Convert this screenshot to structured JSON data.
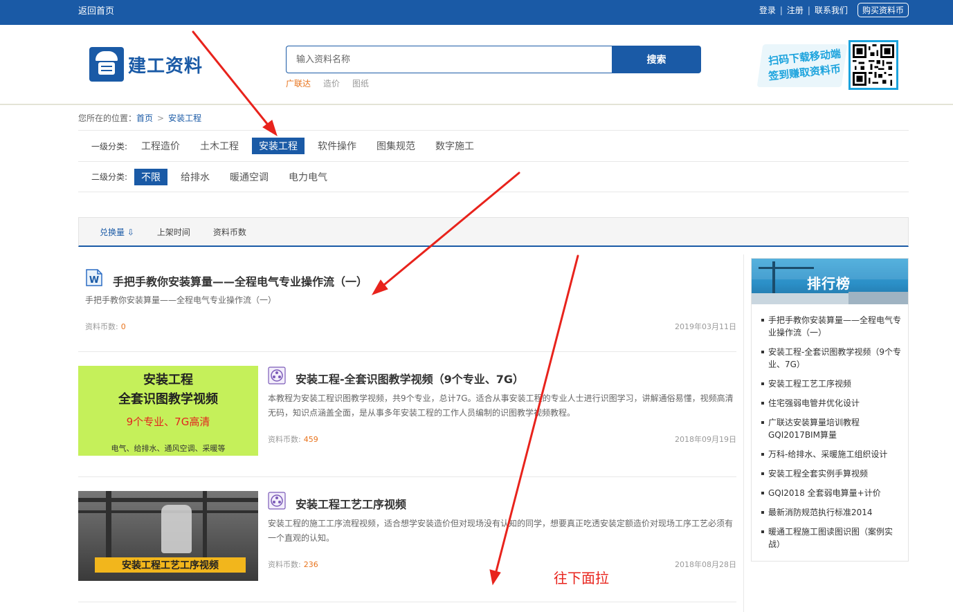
{
  "topbar": {
    "back_label": "返回首页",
    "login": "登录",
    "register": "注册",
    "contact": "联系我们",
    "buy": "购买资料币",
    "separator": "|"
  },
  "header": {
    "logo_text": "建工资料",
    "search_placeholder": "输入资料名称",
    "search_button": "搜索",
    "hot_keywords": [
      "广联达",
      "造价",
      "图纸"
    ],
    "promo_line1": "扫码下载移动端",
    "promo_line2": "签到赚取资料币"
  },
  "breadcrumb": {
    "prefix": "您所在的位置：",
    "home": "首页",
    "sep": ">",
    "current": "安装工程"
  },
  "filters": {
    "level1_label": "一级分类:",
    "level1": [
      "工程造价",
      "土木工程",
      "安装工程",
      "软件操作",
      "图集规范",
      "数字施工"
    ],
    "level1_active": "安装工程",
    "level2_label": "二级分类:",
    "level2": [
      "不限",
      "给排水",
      "暖通空调",
      "电力电气"
    ],
    "level2_active": "不限"
  },
  "sort": [
    "兑换量 ⇩",
    "上架时间",
    "资料币数"
  ],
  "items": [
    {
      "title": "手把手教你安装算量——全程电气专业操作流（一）",
      "desc": "手把手教你安装算量——全程电气专业操作流（一）",
      "coin_label": "资料币数:",
      "coin": "0",
      "date": "2019年03月11日"
    },
    {
      "title": "安装工程-全套识图教学视频（9个专业、7G）",
      "desc": "本教程为安装工程识图教学视频，共9个专业，总计7G。适合从事安装工程的专业人士进行识图学习，讲解通俗易懂，视频高清无码，知识点涵盖全面，是从事多年安装工程的工作人员编制的识图教学视频教程。",
      "coin_label": "资料币数:",
      "coin": "459",
      "date": "2018年09月19日",
      "thumb": {
        "line1": "安装工程",
        "line2": "全套识图教学视频",
        "line3": "9个专业、7G高清",
        "line4": "电气、给排水、通风空调、采暖等"
      }
    },
    {
      "title": "安装工程工艺工序视频",
      "desc": "安装工程的施工工序流程视频，适合想学安装造价但对现场没有认知的同学，想要真正吃透安装定额造价对现场工序工艺必须有一个直观的认知。",
      "coin_label": "资料币数:",
      "coin": "236",
      "date": "2018年08月28日",
      "thumb": {
        "caption": "安装工程工艺工序视频"
      }
    }
  ],
  "ranking": {
    "title": "排行榜",
    "items": [
      "手把手教你安装算量——全程电气专业操作流（一）",
      "安装工程-全套识图教学视频（9个专业、7G）",
      "安装工程工艺工序视频",
      "住宅强弱电管井优化设计",
      "广联达安装算量培训教程GQI2017BIM算量",
      "万科-给排水、采暖施工组织设计",
      "安装工程全套实例手算视频",
      "GQI2018 全套弱电算量+计价",
      "最新消防规范执行标准2014",
      "暖通工程施工图读图识图（案例实战）"
    ]
  },
  "annotation": {
    "scroll_hint": "往下面拉",
    "color": "#e8231c"
  },
  "colors": {
    "brand": "#1a5aa6",
    "accent_orange": "#e8731c"
  }
}
